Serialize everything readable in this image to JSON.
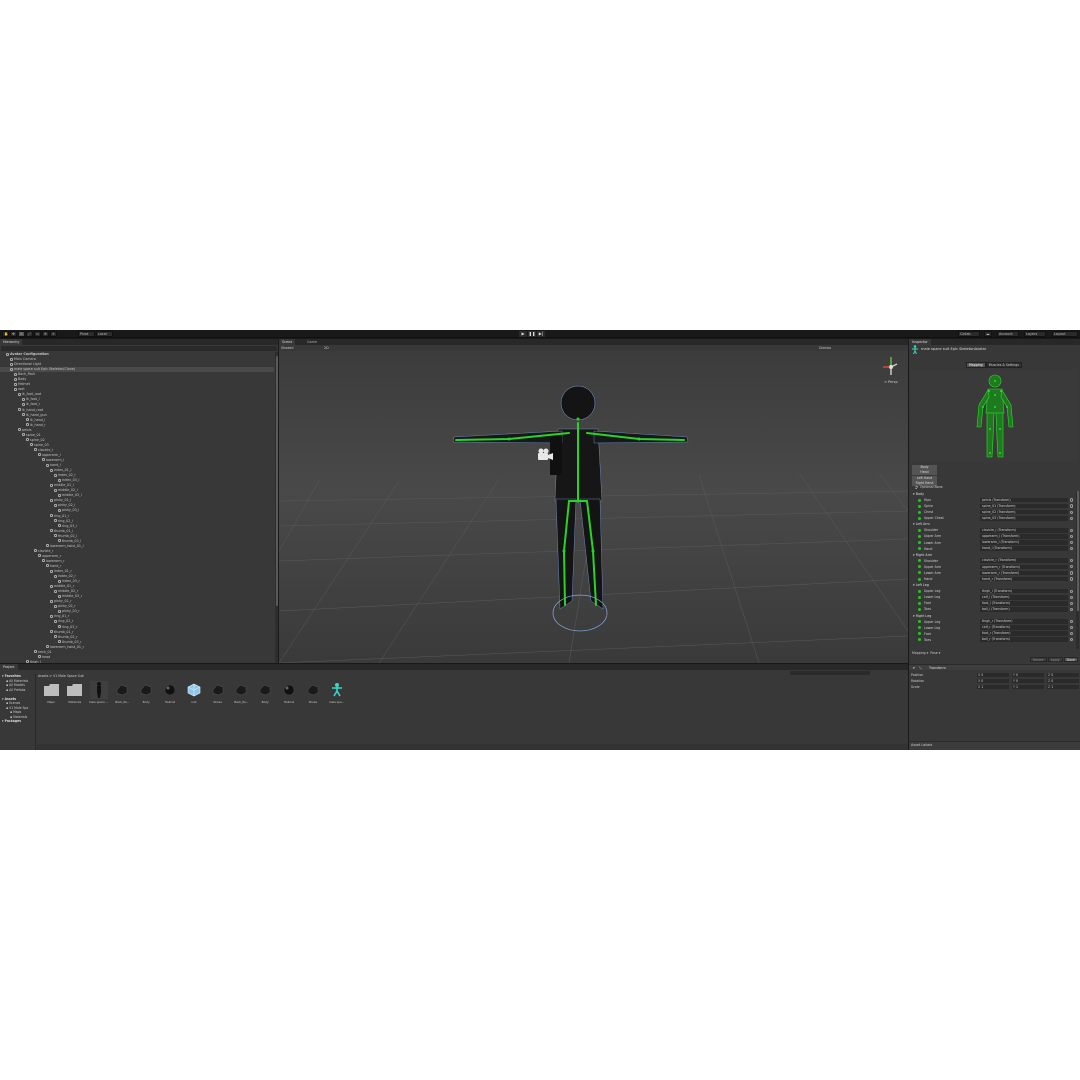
{
  "toolbar": {
    "buttons": [
      "Pivot",
      "Local"
    ],
    "right": {
      "collab": "Collab",
      "account": "Account",
      "layers": "Layers",
      "layout": "Layout"
    }
  },
  "hierarchy": {
    "tab": "Hierarchy",
    "rows": [
      {
        "label": "Avatar Configuration",
        "depth": 0,
        "sel": false,
        "bold": true
      },
      {
        "label": "Main Camera",
        "depth": 1
      },
      {
        "label": "Directional Light",
        "depth": 1
      },
      {
        "label": "male space suit Epic Skeleton(Clone)",
        "depth": 1,
        "sel": true
      },
      {
        "label": "Back_Pack",
        "depth": 2
      },
      {
        "label": "Body",
        "depth": 2
      },
      {
        "label": "Helmet",
        "depth": 2
      },
      {
        "label": "root",
        "depth": 2
      },
      {
        "label": "ik_foot_root",
        "depth": 3
      },
      {
        "label": "ik_foot_l",
        "depth": 4
      },
      {
        "label": "ik_foot_r",
        "depth": 4
      },
      {
        "label": "ik_hand_root",
        "depth": 3
      },
      {
        "label": "ik_hand_gun",
        "depth": 4
      },
      {
        "label": "ik_hand_l",
        "depth": 5
      },
      {
        "label": "ik_hand_r",
        "depth": 5
      },
      {
        "label": "pelvis",
        "depth": 3
      },
      {
        "label": "spine_01",
        "depth": 4
      },
      {
        "label": "spine_02",
        "depth": 5
      },
      {
        "label": "spine_03",
        "depth": 6
      },
      {
        "label": "clavicle_l",
        "depth": 7
      },
      {
        "label": "upperarm_l",
        "depth": 8
      },
      {
        "label": "lowerarm_l",
        "depth": 9
      },
      {
        "label": "hand_l",
        "depth": 10
      },
      {
        "label": "index_01_l",
        "depth": 11
      },
      {
        "label": "index_02_l",
        "depth": 12
      },
      {
        "label": "index_03_l",
        "depth": 13
      },
      {
        "label": "middle_01_l",
        "depth": 11
      },
      {
        "label": "middle_02_l",
        "depth": 12
      },
      {
        "label": "middle_03_l",
        "depth": 13
      },
      {
        "label": "pinky_01_l",
        "depth": 11
      },
      {
        "label": "pinky_02_l",
        "depth": 12
      },
      {
        "label": "pinky_03_l",
        "depth": 13
      },
      {
        "label": "ring_01_l",
        "depth": 11
      },
      {
        "label": "ring_02_l",
        "depth": 12
      },
      {
        "label": "ring_03_l",
        "depth": 13
      },
      {
        "label": "thumb_01_l",
        "depth": 11
      },
      {
        "label": "thumb_02_l",
        "depth": 12
      },
      {
        "label": "thumb_03_l",
        "depth": 13
      },
      {
        "label": "lowerarm_twist_01_l",
        "depth": 10
      },
      {
        "label": "clavicle_r",
        "depth": 7
      },
      {
        "label": "upperarm_r",
        "depth": 8
      },
      {
        "label": "lowerarm_r",
        "depth": 9
      },
      {
        "label": "hand_r",
        "depth": 10
      },
      {
        "label": "index_01_r",
        "depth": 11
      },
      {
        "label": "index_02_r",
        "depth": 12
      },
      {
        "label": "index_03_r",
        "depth": 13
      },
      {
        "label": "middle_01_r",
        "depth": 11
      },
      {
        "label": "middle_02_r",
        "depth": 12
      },
      {
        "label": "middle_03_r",
        "depth": 13
      },
      {
        "label": "pinky_01_r",
        "depth": 11
      },
      {
        "label": "pinky_02_r",
        "depth": 12
      },
      {
        "label": "pinky_03_r",
        "depth": 13
      },
      {
        "label": "ring_01_r",
        "depth": 11
      },
      {
        "label": "ring_02_r",
        "depth": 12
      },
      {
        "label": "ring_03_r",
        "depth": 13
      },
      {
        "label": "thumb_01_r",
        "depth": 11
      },
      {
        "label": "thumb_02_r",
        "depth": 12
      },
      {
        "label": "thumb_03_r",
        "depth": 13
      },
      {
        "label": "lowerarm_twist_01_r",
        "depth": 10
      },
      {
        "label": "neck_01",
        "depth": 7
      },
      {
        "label": "head",
        "depth": 8
      },
      {
        "label": "thigh_l",
        "depth": 5
      }
    ]
  },
  "scene": {
    "tabs": [
      "Scene",
      "Game"
    ],
    "shading": "Shaded",
    "mode": "2D",
    "gizmos": "Gizmos",
    "persp": "< Persp"
  },
  "inspector": {
    "tab": "Inspector",
    "title": "male space suit Epic SkeletonAvatar",
    "tabs": [
      "Mapping",
      "Muscles & Settings"
    ],
    "body_buttons": [
      "Body",
      "Head",
      "Left Hand",
      "Right Hand"
    ],
    "optional_bone": "Optional Bone",
    "groups": [
      {
        "name": "Body",
        "bones": [
          {
            "name": "Hips",
            "value": "pelvis (Transform)"
          },
          {
            "name": "Spine",
            "value": "spine_01 (Transform)"
          },
          {
            "name": "Chest",
            "value": "spine_02 (Transform)"
          },
          {
            "name": "Upper Chest",
            "value": "spine_03 (Transform)"
          }
        ]
      },
      {
        "name": "Left Arm",
        "bones": [
          {
            "name": "Shoulder",
            "value": "clavicle_l (Transform)"
          },
          {
            "name": "Upper Arm",
            "value": "upperarm_l (Transform)"
          },
          {
            "name": "Lower Arm",
            "value": "lowerarm_l (Transform)"
          },
          {
            "name": "Hand",
            "value": "hand_l (Transform)"
          }
        ]
      },
      {
        "name": "Right Arm",
        "bones": [
          {
            "name": "Shoulder",
            "value": "clavicle_r (Transform)"
          },
          {
            "name": "Upper Arm",
            "value": "upperarm_r (Transform)"
          },
          {
            "name": "Lower Arm",
            "value": "lowerarm_r (Transform)"
          },
          {
            "name": "Hand",
            "value": "hand_r (Transform)"
          }
        ]
      },
      {
        "name": "Left Leg",
        "bones": [
          {
            "name": "Upper Leg",
            "value": "thigh_l (Transform)"
          },
          {
            "name": "Lower Leg",
            "value": "calf_l (Transform)"
          },
          {
            "name": "Foot",
            "value": "foot_l (Transform)"
          },
          {
            "name": "Toes",
            "value": "ball_l (Transform)"
          }
        ]
      },
      {
        "name": "Right Leg",
        "bones": [
          {
            "name": "Upper Leg",
            "value": "thigh_r (Transform)"
          },
          {
            "name": "Lower Leg",
            "value": "calf_r (Transform)"
          },
          {
            "name": "Foot",
            "value": "foot_r (Transform)"
          },
          {
            "name": "Toes",
            "value": "ball_r (Transform)"
          }
        ]
      }
    ],
    "mapping_label": "Mapping",
    "pose_label": "Pose",
    "buttons": [
      "Revert",
      "Apply",
      "Done"
    ],
    "transform": {
      "header": "Transform",
      "rows": [
        {
          "label": "Position",
          "x": "0",
          "y": "0",
          "z": "0"
        },
        {
          "label": "Rotation",
          "x": "0",
          "y": "0",
          "z": "0"
        },
        {
          "label": "Scale",
          "x": "1",
          "y": "1",
          "z": "1"
        }
      ]
    },
    "asset_labels": "Asset Labels"
  },
  "project": {
    "tab": "Project",
    "tree": [
      {
        "label": "Favorites",
        "bold": true,
        "depth": 0
      },
      {
        "label": "All Materials",
        "depth": 1
      },
      {
        "label": "All Models",
        "depth": 1
      },
      {
        "label": "All Prefabs",
        "depth": 1
      },
      {
        "label": "",
        "depth": 0
      },
      {
        "label": "Assets",
        "bold": true,
        "depth": 0
      },
      {
        "label": "Scenes",
        "depth": 1
      },
      {
        "label": "V1 Male Spa",
        "depth": 1
      },
      {
        "label": "Maps",
        "depth": 2
      },
      {
        "label": "Materials",
        "depth": 2
      },
      {
        "label": "Packages",
        "bold": true,
        "depth": 0
      }
    ],
    "breadcrumb": "Assets > V1 Male Space Suit",
    "items": [
      {
        "label": "Maps",
        "icon": "folder"
      },
      {
        "label": "Materials",
        "icon": "folder"
      },
      {
        "label": "male space ...",
        "icon": "model",
        "sel": true
      },
      {
        "label": "Back_Pa...",
        "icon": "mesh"
      },
      {
        "label": "Body",
        "icon": "mesh"
      },
      {
        "label": "Helmet",
        "icon": "sphere"
      },
      {
        "label": "root",
        "icon": "cube"
      },
      {
        "label": "Shoes",
        "icon": "mesh"
      },
      {
        "label": "Back_Pa...",
        "icon": "mesh"
      },
      {
        "label": "Body",
        "icon": "mesh"
      },
      {
        "label": "Helmet",
        "icon": "sphere"
      },
      {
        "label": "Shoes",
        "icon": "mesh"
      },
      {
        "label": "male spa...",
        "icon": "avatar"
      }
    ]
  }
}
